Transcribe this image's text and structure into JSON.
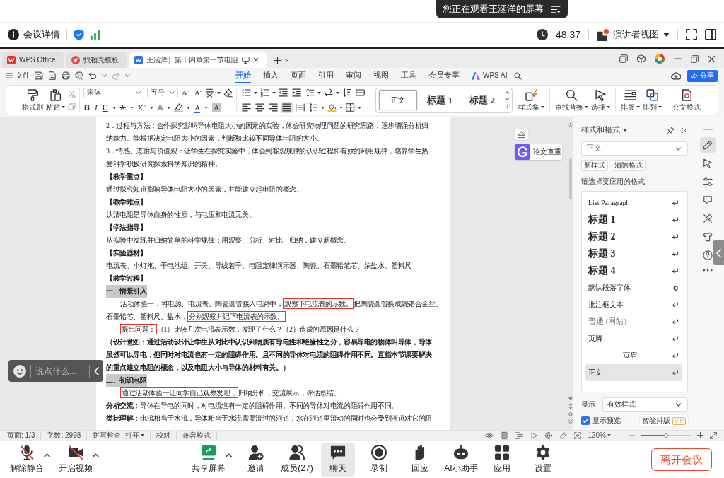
{
  "share_banner": {
    "text": "您正在观看王涵洋的屏幕"
  },
  "meeting_header": {
    "info": "会议详情",
    "timer": "48:37",
    "view_menu": "演讲者视图"
  },
  "app_tabs": [
    {
      "kind": "home",
      "label": "WPS Office",
      "selected": false
    },
    {
      "kind": "template",
      "label": "找稻壳模板",
      "selected": false
    },
    {
      "kind": "document",
      "label": "王涵洋）第十四章第一节电阻",
      "selected": true
    }
  ],
  "menu": {
    "file": "文件",
    "tabs": [
      {
        "label": "开始",
        "selected": true
      },
      {
        "label": "插入",
        "selected": false
      },
      {
        "label": "页面",
        "selected": false
      },
      {
        "label": "引用",
        "selected": false
      },
      {
        "label": "审阅",
        "selected": false
      },
      {
        "label": "视图",
        "selected": false
      },
      {
        "label": "工具",
        "selected": false
      },
      {
        "label": "会员专享",
        "selected": false
      }
    ],
    "ai": "WPS AI",
    "share": "分享"
  },
  "ribbon": {
    "clipboard": [
      {
        "kind": "painter",
        "label": "格式刷",
        "menu": false
      },
      {
        "kind": "paste",
        "label": "粘贴",
        "menu": true
      }
    ],
    "font_name": "宋体",
    "font_size": "五号",
    "grow": "A$^{+}$",
    "shrink": "A$^{-}$",
    "font_buttons": [
      {
        "kind": "bold",
        "text": "B",
        "menu": false
      },
      {
        "kind": "italic",
        "text": "I",
        "menu": false
      },
      {
        "kind": "underline",
        "text": "U",
        "menu": true
      },
      {
        "kind": "strike",
        "text": "A",
        "menu": true
      },
      {
        "kind": "superscript",
        "text": "X$^{2}$",
        "menu": true
      },
      {
        "kind": "effect",
        "text": "A",
        "menu": true
      },
      {
        "kind": "highlight",
        "menu": true
      },
      {
        "kind": "color",
        "text": "A",
        "menu": true
      },
      {
        "kind": "shading",
        "text": "A",
        "menu": false
      }
    ],
    "alignment": [
      {
        "kind": "left",
        "selected": false
      },
      {
        "kind": "center",
        "selected": false
      },
      {
        "kind": "right",
        "selected": false
      },
      {
        "kind": "justify",
        "selected": true
      },
      {
        "kind": "distribute",
        "selected": false
      }
    ],
    "gallery": [
      {
        "kind": "normal",
        "label": "正文",
        "selected": true
      },
      {
        "kind": "heading",
        "label": "标题 1",
        "selected": false
      },
      {
        "kind": "heading",
        "label": "标题 2",
        "selected": false
      }
    ],
    "commands": [
      {
        "kind": "styles",
        "label": "样式集",
        "menu": true
      },
      {
        "kind": "find",
        "label": "查找替换",
        "menu": true
      },
      {
        "kind": "select",
        "label": "选择",
        "menu": true
      },
      {
        "kind": "layout",
        "label": "排版",
        "menu": true
      },
      {
        "kind": "arrange",
        "label": "排列",
        "menu": true
      },
      {
        "kind": "official",
        "label": "公文模式",
        "menu": false
      }
    ]
  },
  "document": {
    "paragraphs": [
      {
        "kind": "body",
        "lines": [
          "2．过程与方法：合作探究影响导体电阻大小的因素的实验，体会研究物理问题的研究思路，逐步增强分析归",
          "纳能力。能根据决定电阻大小的因素，判断和比较不同导体电阻的大小。"
        ]
      },
      {
        "kind": "body",
        "lines": [
          "3．情感、态度与价值观：让学生在探究实验中，体会到客观规律的认识过程和有效的利用规律，培养学生热",
          "爱科学积极研究探索科学知识的精神。"
        ]
      },
      {
        "kind": "heading",
        "lines": [
          "【教学重点】"
        ]
      },
      {
        "kind": "body",
        "lines": [
          "通过探究知道影响导体电阻大小的因素，并能建立起电阻的概念。"
        ]
      },
      {
        "kind": "heading",
        "lines": [
          "【教学难点】"
        ]
      },
      {
        "kind": "body",
        "lines": [
          "认清电阻是导体自身的性质，与电压和电流无关。"
        ]
      },
      {
        "kind": "heading",
        "lines": [
          "【学法指导】"
        ]
      },
      {
        "kind": "body",
        "lines": [
          "从实验中发现并归纳简单的科学规律；用观察、分析、对比、归纳，建立新概念。"
        ]
      },
      {
        "kind": "heading",
        "lines": [
          "【实验器材】"
        ]
      },
      {
        "kind": "body",
        "lines": [
          "电流表、小灯泡、干电池组、开关、导线若干、电阻定律演示器、陶瓷、石墨铅笔芯、浓盐水、塑料尺"
        ]
      },
      {
        "kind": "heading",
        "lines": [
          "【教学过程】"
        ]
      },
      {
        "kind": "section",
        "lines": [
          "一、情景引入"
        ]
      },
      {
        "kind": "indented",
        "lines": [
          [
            {
              "text": "活动体验一：将电源、电流表、陶瓷圆管接入电路中，",
              "boxed": false
            },
            {
              "text": "观察下电流表的示数。",
              "boxed": true
            },
            {
              "text": "把陶瓷圆管换成镍铬合金丝、",
              "boxed": false
            }
          ],
          [
            {
              "text": "石墨铅芯、塑料尺、盐水，",
              "boxed": false
            },
            {
              "text": "分别观察并记下电流表的示数。",
              "boxed": true
            }
          ]
        ]
      },
      {
        "kind": "indented",
        "lines": [
          [
            {
              "text": "提出问题：",
              "boxed": true
            },
            {
              "text": "（1）比较几次电流表示数，发现了什么？（2）造成的原因是什么？",
              "boxed": false
            }
          ]
        ]
      },
      {
        "kind": "note",
        "lines": [
          "（设计意图：通过活动设计让学生从对比中认识到物质有导电性和绝缘性之分，容易导电的物体叫导体，导体",
          "虽然可以导电，但同时对电流也有一定的阻碍作用。且不同的导体对电流的阻碍作用不同。直指本节课要解决",
          "的重点建立电阻的概念，以及电阻大小与导体的材料有关。）"
        ]
      },
      {
        "kind": "section",
        "lines": [
          "二、初识电阻"
        ]
      },
      {
        "kind": "indented",
        "lines": [
          [
            {
              "text": "通过活动体验一让同学自己观察发现，",
              "boxed": true
            },
            {
              "text": "归纳分析，交流展示，评估总结。",
              "boxed": false
            }
          ]
        ]
      },
      {
        "kind": "body",
        "lines": [
          "**分析交流：**导体在导电的同时，对电流也有一定的阻碍作用。不同的导体对电流的阻碍作用不同。"
        ]
      },
      {
        "kind": "body",
        "lines": [
          "**类比理解：**电流相当于水流，导体相当于水流需要流过的河道，水在河道里流动的同时也会受到河道对它的阻"
        ]
      }
    ]
  },
  "side_tools": {
    "check": "论文查重"
  },
  "styles_panel": {
    "title": "样式和格式",
    "current": "正文",
    "buttons": [
      "新样式",
      "清除格式"
    ],
    "prompt": "请选择要应用的格式",
    "styles": [
      {
        "label": "List Paragraph",
        "kind": "serif",
        "character": false,
        "selected": false
      },
      {
        "label": "标题 1",
        "kind": "heading",
        "character": false,
        "selected": false
      },
      {
        "label": "标题 2",
        "kind": "heading",
        "character": false,
        "selected": false
      },
      {
        "label": "标题 3",
        "kind": "heading",
        "character": false,
        "selected": false
      },
      {
        "label": "标题 4",
        "kind": "heading",
        "character": false,
        "selected": false
      },
      {
        "label": "默认段落字体",
        "kind": "plain",
        "character": true,
        "selected": false
      },
      {
        "label": "批注框文本",
        "kind": "plain",
        "character": false,
        "selected": false
      },
      {
        "label": "普通 (网站)",
        "kind": "web",
        "character": false,
        "selected": false
      },
      {
        "label": "页脚",
        "kind": "plain",
        "character": false,
        "selected": false
      },
      {
        "label": "页眉",
        "kind": "centered",
        "character": false,
        "selected": false
      },
      {
        "label": "正文",
        "kind": "serif",
        "character": false,
        "selected": true
      }
    ],
    "show_label": "显示",
    "show_value": "有效样式",
    "preview": {
      "label": "显示预览",
      "checked": true
    },
    "smart_button": "智能排版",
    "badge": "VIP"
  },
  "right_tools": [
    {
      "kind": "edit",
      "selected": true
    },
    {
      "kind": "pointer",
      "selected": false
    },
    {
      "kind": "sliders",
      "selected": false
    },
    {
      "kind": "bubble",
      "selected": false
    },
    {
      "kind": "tools",
      "selected": false
    },
    {
      "kind": "shirt",
      "selected": false
    },
    {
      "kind": "help",
      "selected": false
    },
    {
      "kind": "more",
      "selected": false
    }
  ],
  "chat_box": {
    "placeholder": "说点什么..."
  },
  "status_bar": {
    "items": [
      {
        "label": "页面: 1/3",
        "menu": false
      },
      {
        "label": "字数: 2998",
        "menu": false
      },
      {
        "label": "拼写检查: 打开",
        "menu": true
      },
      {
        "label": "校对",
        "menu": false
      },
      {
        "label": "兼容模式",
        "menu": false
      }
    ],
    "views": [
      {
        "kind": "eye",
        "selected": false
      },
      {
        "kind": "page",
        "selected": true
      },
      {
        "kind": "outline",
        "selected": false
      },
      {
        "kind": "play",
        "selected": false
      },
      {
        "kind": "web",
        "selected": false
      },
      {
        "kind": "pen",
        "selected": false
      }
    ],
    "zoom": "120%",
    "zoom_slider": {
      "level": 0.5
    }
  },
  "toolbar": {
    "left": [
      {
        "kind": "mic",
        "label": "解除静音",
        "menu": true,
        "selected": false
      },
      {
        "kind": "camera",
        "label": "开启视频",
        "menu": true,
        "selected": false
      }
    ],
    "center": [
      {
        "kind": "share",
        "label": "共享屏幕",
        "menu": true,
        "selected": false
      },
      {
        "kind": "invite",
        "label": "邀请",
        "menu": false,
        "selected": false
      },
      {
        "kind": "members",
        "label": "成员(27)",
        "menu": false,
        "selected": false
      },
      {
        "kind": "chat",
        "label": "聊天",
        "menu": false,
        "selected": true
      },
      {
        "kind": "record",
        "label": "录制",
        "menu": false,
        "selected": false
      },
      {
        "kind": "react",
        "label": "回应",
        "menu": false,
        "selected": false
      },
      {
        "kind": "assistant",
        "label": "AI小助手",
        "menu": false,
        "selected": false
      },
      {
        "kind": "apps",
        "label": "应用",
        "menu": false,
        "selected": false
      },
      {
        "kind": "settings",
        "label": "设置",
        "menu": false,
        "selected": false
      }
    ],
    "leave": "离开会议"
  }
}
